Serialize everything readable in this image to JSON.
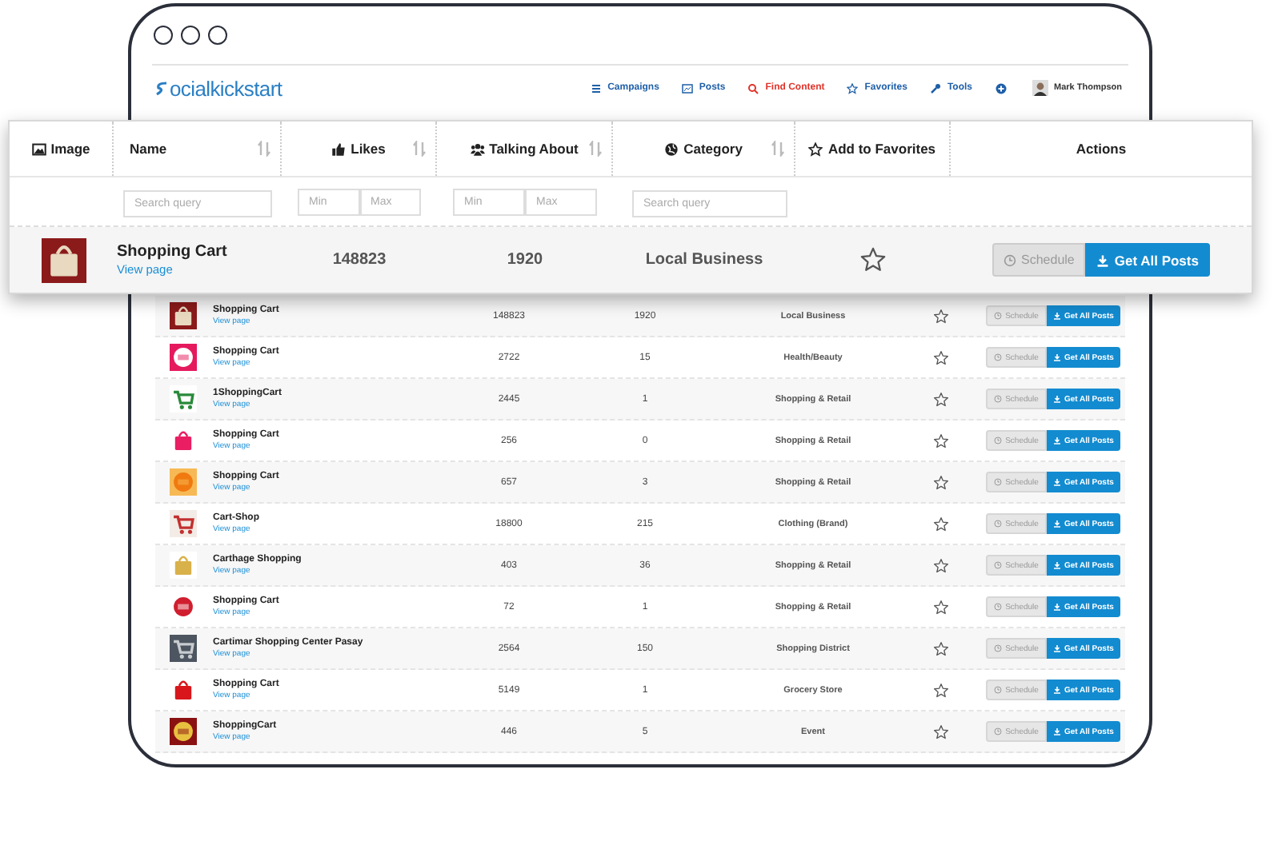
{
  "logo": {
    "text": "ocialkickstart"
  },
  "nav": [
    {
      "label": "Campaigns",
      "selected": false
    },
    {
      "label": "Posts",
      "selected": false
    },
    {
      "label": "Find Content",
      "selected": true
    },
    {
      "label": "Favorites",
      "selected": false
    },
    {
      "label": "Tools",
      "selected": false
    }
  ],
  "user": {
    "name": "Mark Thompson"
  },
  "zoomed_table": {
    "columns": [
      {
        "label": "Image",
        "sortable": false
      },
      {
        "label": "Name",
        "sortable": true
      },
      {
        "label": "Likes",
        "sortable": true
      },
      {
        "label": "Talking About",
        "sortable": true
      },
      {
        "label": "Category",
        "sortable": true
      },
      {
        "label": "Add to Favorites",
        "sortable": false
      },
      {
        "label": "Actions",
        "sortable": false
      }
    ],
    "filters": {
      "name_placeholder": "Search query",
      "likes_min_placeholder": "Min",
      "likes_max_placeholder": "Max",
      "talking_min_placeholder": "Min",
      "talking_max_placeholder": "Max",
      "category_placeholder": "Search query"
    },
    "row": {
      "name": "Shopping Cart",
      "link": "View page",
      "likes": "148823",
      "talking_about": "1920",
      "category": "Local Business",
      "favorite": false,
      "schedule": "Schedule",
      "get_posts": "Get All Posts"
    }
  },
  "table": {
    "rows": [
      {
        "name": "Shopping Cart",
        "link": "View page",
        "likes": "148823",
        "talking_about": "1920",
        "category": "Local Business",
        "favorite": false,
        "schedule": "Schedule",
        "get_posts": "Get All Posts"
      },
      {
        "name": "Shopping Cart",
        "link": "View page",
        "likes": "2722",
        "talking_about": "15",
        "category": "Health/Beauty",
        "favorite": false,
        "schedule": "Schedule",
        "get_posts": "Get All Posts"
      },
      {
        "name": "1ShoppingCart",
        "link": "View page",
        "likes": "2445",
        "talking_about": "1",
        "category": "Shopping & Retail",
        "favorite": false,
        "schedule": "Schedule",
        "get_posts": "Get All Posts"
      },
      {
        "name": "Shopping Cart",
        "link": "View page",
        "likes": "256",
        "talking_about": "0",
        "category": "Shopping & Retail",
        "favorite": false,
        "schedule": "Schedule",
        "get_posts": "Get All Posts"
      },
      {
        "name": "Shopping Cart",
        "link": "View page",
        "likes": "657",
        "talking_about": "3",
        "category": "Shopping & Retail",
        "favorite": false,
        "schedule": "Schedule",
        "get_posts": "Get All Posts"
      },
      {
        "name": "Cart-Shop",
        "link": "View page",
        "likes": "18800",
        "talking_about": "215",
        "category": "Clothing (Brand)",
        "favorite": false,
        "schedule": "Schedule",
        "get_posts": "Get All Posts"
      },
      {
        "name": "Carthage Shopping",
        "link": "View page",
        "likes": "403",
        "talking_about": "36",
        "category": "Shopping & Retail",
        "favorite": false,
        "schedule": "Schedule",
        "get_posts": "Get All Posts"
      },
      {
        "name": "Shopping Cart",
        "link": "View page",
        "likes": "72",
        "talking_about": "1",
        "category": "Shopping & Retail",
        "favorite": false,
        "schedule": "Schedule",
        "get_posts": "Get All Posts"
      },
      {
        "name": "Cartimar Shopping Center Pasay",
        "link": "View page",
        "likes": "2564",
        "talking_about": "150",
        "category": "Shopping District",
        "favorite": false,
        "schedule": "Schedule",
        "get_posts": "Get All Posts"
      },
      {
        "name": "Shopping Cart",
        "link": "View page",
        "likes": "5149",
        "talking_about": "1",
        "category": "Grocery Store",
        "favorite": false,
        "schedule": "Schedule",
        "get_posts": "Get All Posts"
      },
      {
        "name": "ShoppingCart",
        "link": "View page",
        "likes": "446",
        "talking_about": "5",
        "category": "Event",
        "favorite": false,
        "schedule": "Schedule",
        "get_posts": "Get All Posts"
      }
    ]
  }
}
